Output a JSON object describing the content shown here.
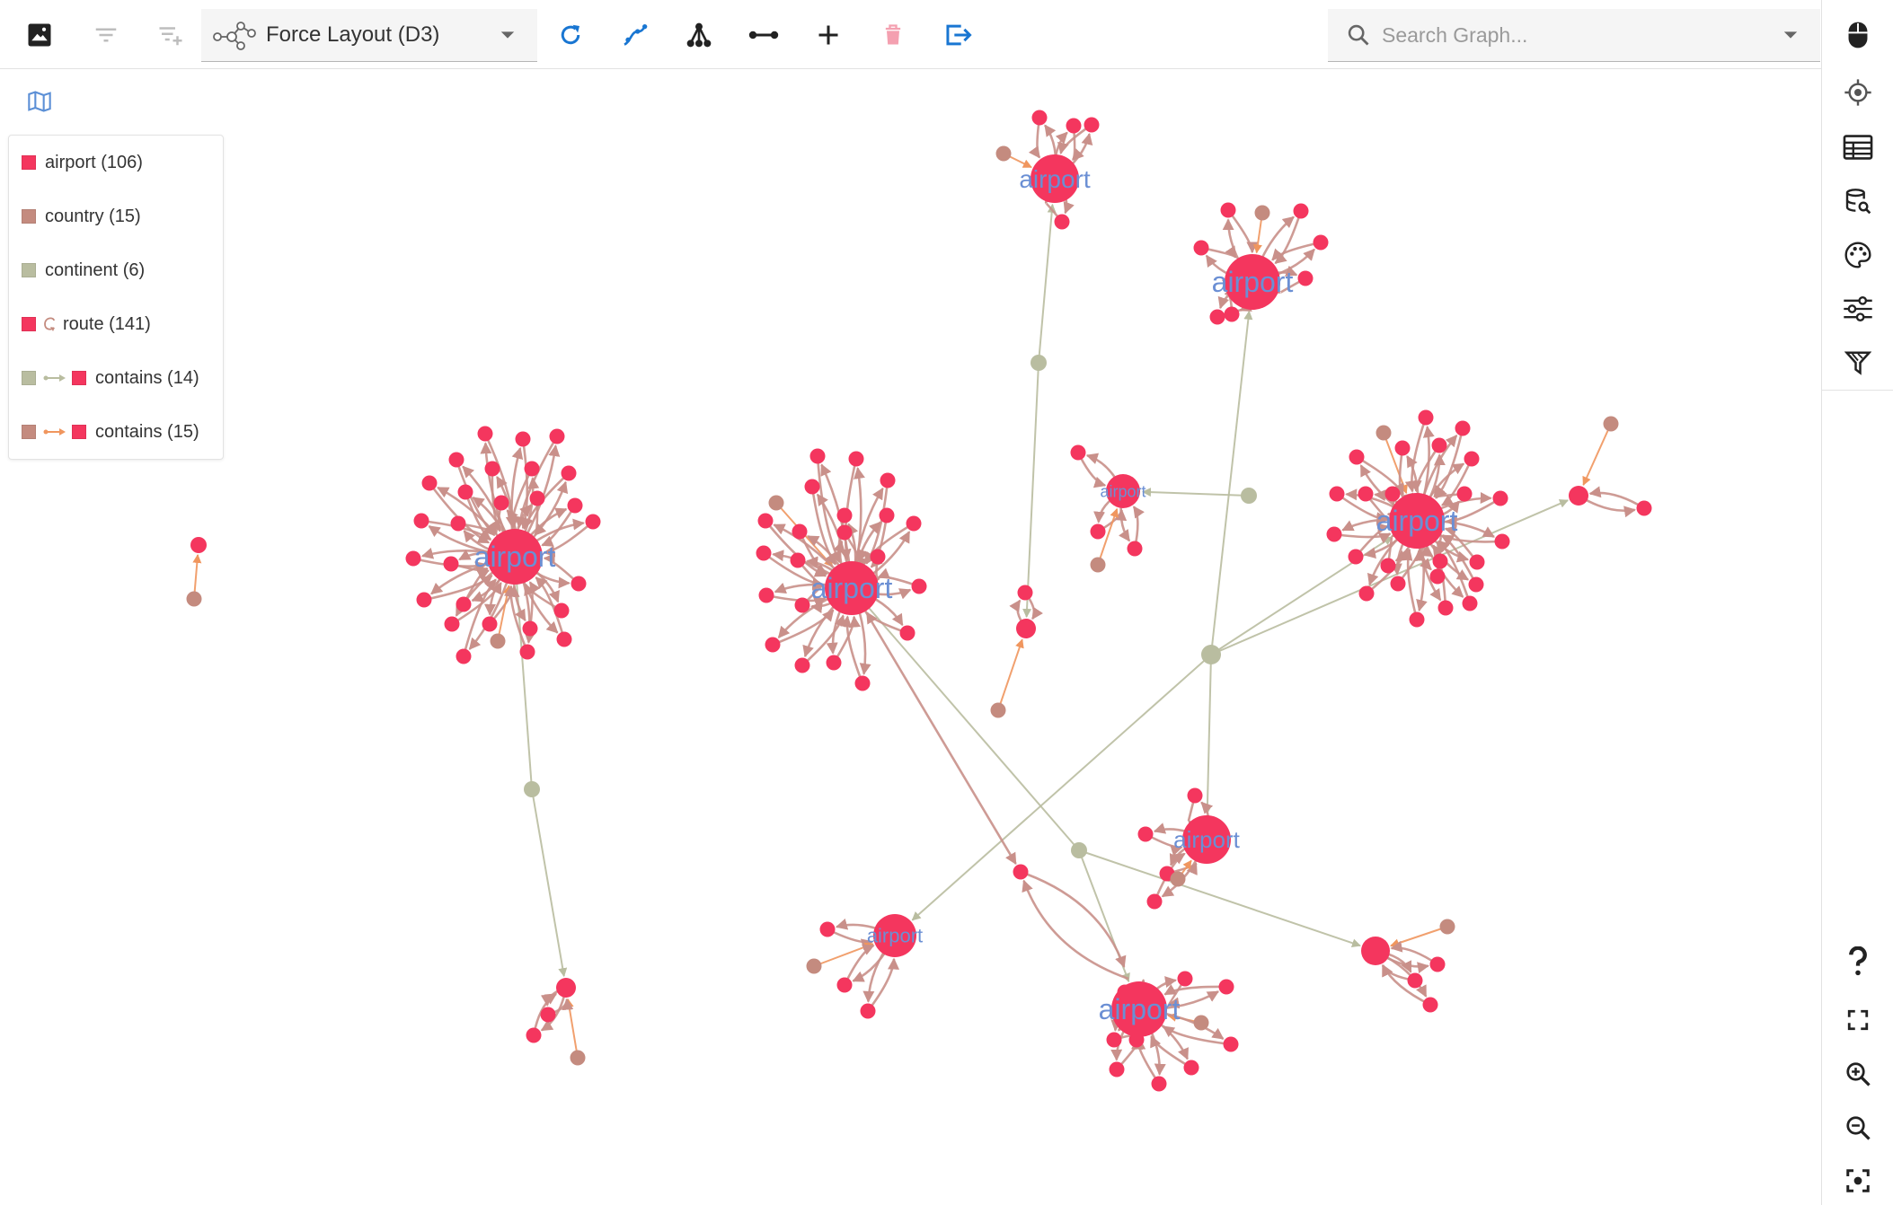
{
  "toolbar": {
    "layout_label": "Force Layout (D3)",
    "search_placeholder": "Search Graph..."
  },
  "legend": {
    "items": [
      {
        "label": "airport (106)",
        "color": "#f4365e"
      },
      {
        "label": "country (15)",
        "color": "#c48b7f"
      },
      {
        "label": "continent (6)",
        "color": "#b9bda0"
      },
      {
        "label": "route (141)",
        "color": "#f4365e"
      },
      {
        "label": "contains (14)",
        "from": "#b9bda0",
        "to": "#f4365e"
      },
      {
        "label": "contains (15)",
        "from": "#c48b7f",
        "to": "#f4365e"
      }
    ]
  },
  "graph": {
    "hub_label": "airport",
    "colors": {
      "airport": "#f4365e",
      "country": "#c48b7f",
      "continent": "#b9bda0",
      "route": "#c9908a",
      "contains_continent": "#b9bda0",
      "contains_country": "#f0965e",
      "label": "#6b8fd4"
    }
  }
}
